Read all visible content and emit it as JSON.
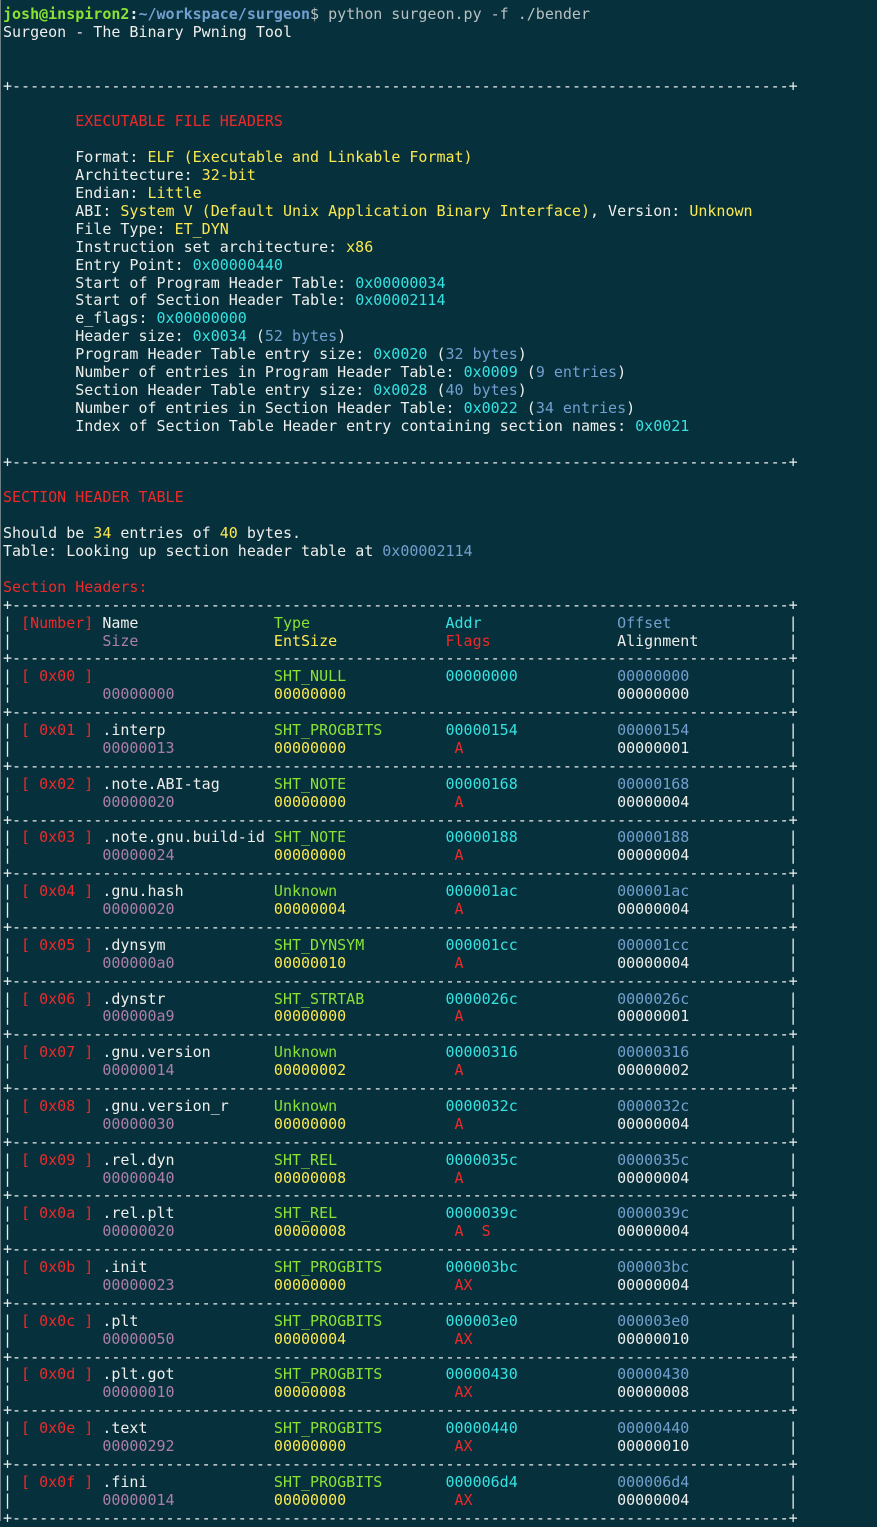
{
  "palette": {
    "background": "#06303b",
    "white": "#eeeeec",
    "grey": "#b8c0c2",
    "red": "#ef2929",
    "green": "#8ae234",
    "yellow": "#fce94f",
    "cyan": "#34e2e2",
    "blue": "#729fcf",
    "purple": "#ad7fa8"
  },
  "prompt": {
    "user_host": "josh@inspiron2",
    "separator": ":",
    "path": "~/workspace/surgeon",
    "symbol": "$",
    "command": " python surgeon.py -f ./bender"
  },
  "banner": "Surgeon - The Binary Pwning Tool",
  "elf_headers": {
    "title": "EXECUTABLE FILE HEADERS",
    "fields": [
      [
        {
          "t": "Format: ",
          "c": "white"
        },
        {
          "t": "ELF (Executable and Linkable Format)",
          "c": "yellow"
        }
      ],
      [
        {
          "t": "Architecture: ",
          "c": "white"
        },
        {
          "t": "32-bit",
          "c": "yellow"
        }
      ],
      [
        {
          "t": "Endian: ",
          "c": "white"
        },
        {
          "t": "Little",
          "c": "yellow"
        }
      ],
      [
        {
          "t": "ABI: ",
          "c": "white"
        },
        {
          "t": "System V (Default Unix Application Binary Interface)",
          "c": "yellow"
        },
        {
          "t": ", Version: ",
          "c": "white"
        },
        {
          "t": "Unknown",
          "c": "yellow"
        }
      ],
      [
        {
          "t": "File Type: ",
          "c": "white"
        },
        {
          "t": "ET_DYN",
          "c": "yellow"
        }
      ],
      [
        {
          "t": "Instruction set architecture: ",
          "c": "white"
        },
        {
          "t": "x86",
          "c": "yellow"
        }
      ],
      [
        {
          "t": "Entry Point: ",
          "c": "white"
        },
        {
          "t": "0x00000440",
          "c": "cyan"
        }
      ],
      [
        {
          "t": "Start of Program Header Table: ",
          "c": "white"
        },
        {
          "t": "0x00000034",
          "c": "cyan"
        }
      ],
      [
        {
          "t": "Start of Section Header Table: ",
          "c": "white"
        },
        {
          "t": "0x00002114",
          "c": "cyan"
        }
      ],
      [
        {
          "t": "e_flags: ",
          "c": "white"
        },
        {
          "t": "0x00000000",
          "c": "cyan"
        }
      ],
      [
        {
          "t": "Header size: ",
          "c": "white"
        },
        {
          "t": "0x0034",
          "c": "cyan"
        },
        {
          "t": " (",
          "c": "white"
        },
        {
          "t": "52 bytes",
          "c": "blue"
        },
        {
          "t": ")",
          "c": "white"
        }
      ],
      [
        {
          "t": "Program Header Table entry size: ",
          "c": "white"
        },
        {
          "t": "0x0020",
          "c": "cyan"
        },
        {
          "t": " (",
          "c": "white"
        },
        {
          "t": "32 bytes",
          "c": "blue"
        },
        {
          "t": ")",
          "c": "white"
        }
      ],
      [
        {
          "t": "Number of entries in Program Header Table: ",
          "c": "white"
        },
        {
          "t": "0x0009",
          "c": "cyan"
        },
        {
          "t": " (",
          "c": "white"
        },
        {
          "t": "9 entries",
          "c": "blue"
        },
        {
          "t": ")",
          "c": "white"
        }
      ],
      [
        {
          "t": "Section Header Table entry size: ",
          "c": "white"
        },
        {
          "t": "0x0028",
          "c": "cyan"
        },
        {
          "t": " (",
          "c": "white"
        },
        {
          "t": "40 bytes",
          "c": "blue"
        },
        {
          "t": ")",
          "c": "white"
        }
      ],
      [
        {
          "t": "Number of entries in Section Header Table: ",
          "c": "white"
        },
        {
          "t": "0x0022",
          "c": "cyan"
        },
        {
          "t": " (",
          "c": "white"
        },
        {
          "t": "34 entries",
          "c": "blue"
        },
        {
          "t": ")",
          "c": "white"
        }
      ],
      [
        {
          "t": "Index of Section Table Header entry containing section names: ",
          "c": "white"
        },
        {
          "t": "0x0021",
          "c": "cyan"
        }
      ]
    ]
  },
  "section_table": {
    "title": "SECTION HEADER TABLE",
    "summary": [
      {
        "t": "Should be ",
        "c": "white"
      },
      {
        "t": "34",
        "c": "yellow"
      },
      {
        "t": " entries of ",
        "c": "white"
      },
      {
        "t": "40",
        "c": "yellow"
      },
      {
        "t": " bytes.",
        "c": "white"
      }
    ],
    "lookup": [
      {
        "t": "Table: Looking up section header table at ",
        "c": "white"
      },
      {
        "t": "0x00002114",
        "c": "blue"
      }
    ],
    "subtitle": "Section Headers:",
    "columns": {
      "number": "[Number]",
      "name": "Name",
      "type": "Type",
      "addr": "Addr",
      "offset": "Offset",
      "size": "Size",
      "entsize": "EntSize",
      "flags": "Flags",
      "alignment": "Alignment"
    },
    "rows": [
      {
        "num": "0x00",
        "name": "",
        "type": "SHT_NULL",
        "addr": "00000000",
        "offset": "00000000",
        "size": "00000000",
        "entsize": "00000000",
        "flags": "",
        "align": "00000000"
      },
      {
        "num": "0x01",
        "name": ".interp",
        "type": "SHT_PROGBITS",
        "addr": "00000154",
        "offset": "00000154",
        "size": "00000013",
        "entsize": "00000000",
        "flags": "A",
        "align": "00000001"
      },
      {
        "num": "0x02",
        "name": ".note.ABI-tag",
        "type": "SHT_NOTE",
        "addr": "00000168",
        "offset": "00000168",
        "size": "00000020",
        "entsize": "00000000",
        "flags": "A",
        "align": "00000004"
      },
      {
        "num": "0x03",
        "name": ".note.gnu.build-id",
        "type": "SHT_NOTE",
        "addr": "00000188",
        "offset": "00000188",
        "size": "00000024",
        "entsize": "00000000",
        "flags": "A",
        "align": "00000004"
      },
      {
        "num": "0x04",
        "name": ".gnu.hash",
        "type": "Unknown",
        "addr": "000001ac",
        "offset": "000001ac",
        "size": "00000020",
        "entsize": "00000004",
        "flags": "A",
        "align": "00000004"
      },
      {
        "num": "0x05",
        "name": ".dynsym",
        "type": "SHT_DYNSYM",
        "addr": "000001cc",
        "offset": "000001cc",
        "size": "000000a0",
        "entsize": "00000010",
        "flags": "A",
        "align": "00000004"
      },
      {
        "num": "0x06",
        "name": ".dynstr",
        "type": "SHT_STRTAB",
        "addr": "0000026c",
        "offset": "0000026c",
        "size": "000000a9",
        "entsize": "00000000",
        "flags": "A",
        "align": "00000001"
      },
      {
        "num": "0x07",
        "name": ".gnu.version",
        "type": "Unknown",
        "addr": "00000316",
        "offset": "00000316",
        "size": "00000014",
        "entsize": "00000002",
        "flags": "A",
        "align": "00000002"
      },
      {
        "num": "0x08",
        "name": ".gnu.version_r",
        "type": "Unknown",
        "addr": "0000032c",
        "offset": "0000032c",
        "size": "00000030",
        "entsize": "00000000",
        "flags": "A",
        "align": "00000004"
      },
      {
        "num": "0x09",
        "name": ".rel.dyn",
        "type": "SHT_REL",
        "addr": "0000035c",
        "offset": "0000035c",
        "size": "00000040",
        "entsize": "00000008",
        "flags": "A",
        "align": "00000004"
      },
      {
        "num": "0x0a",
        "name": ".rel.plt",
        "type": "SHT_REL",
        "addr": "0000039c",
        "offset": "0000039c",
        "size": "00000020",
        "entsize": "00000008",
        "flags": "A  S",
        "align": "00000004"
      },
      {
        "num": "0x0b",
        "name": ".init",
        "type": "SHT_PROGBITS",
        "addr": "000003bc",
        "offset": "000003bc",
        "size": "00000023",
        "entsize": "00000000",
        "flags": "AX",
        "align": "00000004"
      },
      {
        "num": "0x0c",
        "name": ".plt",
        "type": "SHT_PROGBITS",
        "addr": "000003e0",
        "offset": "000003e0",
        "size": "00000050",
        "entsize": "00000004",
        "flags": "AX",
        "align": "00000010"
      },
      {
        "num": "0x0d",
        "name": ".plt.got",
        "type": "SHT_PROGBITS",
        "addr": "00000430",
        "offset": "00000430",
        "size": "00000010",
        "entsize": "00000008",
        "flags": "AX",
        "align": "00000008"
      },
      {
        "num": "0x0e",
        "name": ".text",
        "type": "SHT_PROGBITS",
        "addr": "00000440",
        "offset": "00000440",
        "size": "00000292",
        "entsize": "00000000",
        "flags": "AX",
        "align": "00000010"
      },
      {
        "num": "0x0f",
        "name": ".fini",
        "type": "SHT_PROGBITS",
        "addr": "000006d4",
        "offset": "000006d4",
        "size": "00000014",
        "entsize": "00000000",
        "flags": "AX",
        "align": "00000004"
      }
    ]
  }
}
